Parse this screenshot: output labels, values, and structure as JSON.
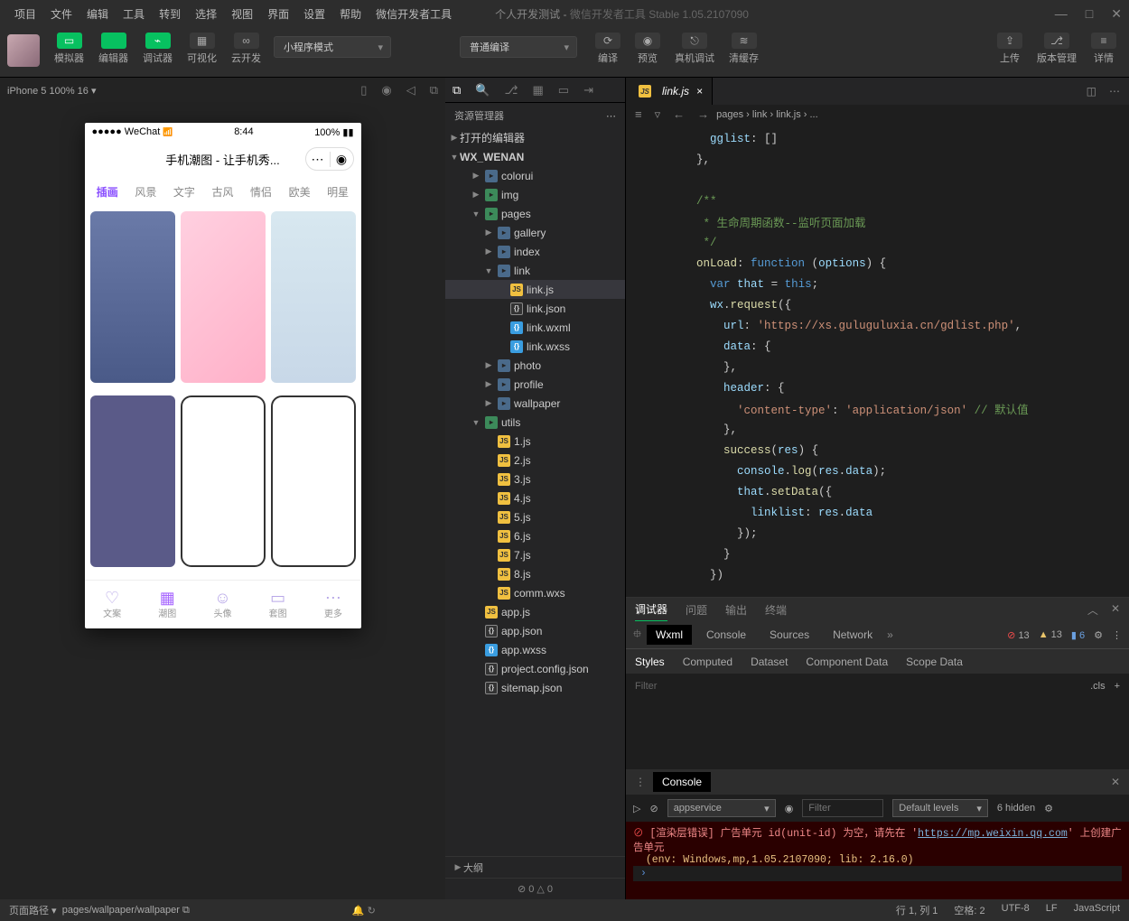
{
  "menubar": [
    "项目",
    "文件",
    "编辑",
    "工具",
    "转到",
    "选择",
    "视图",
    "界面",
    "设置",
    "帮助",
    "微信开发者工具"
  ],
  "title": {
    "project": "个人开发测试",
    "app": "微信开发者工具 Stable 1.05.2107090"
  },
  "win_controls": [
    "—",
    "□",
    "✕"
  ],
  "toolbar": {
    "left": [
      {
        "label": "模拟器",
        "cls": "green",
        "glyph": "▭"
      },
      {
        "label": "编辑器",
        "cls": "green",
        "glyph": "</>"
      },
      {
        "label": "调试器",
        "cls": "green",
        "glyph": "⌁"
      },
      {
        "label": "可视化",
        "cls": "grey",
        "glyph": "▦"
      },
      {
        "label": "云开发",
        "cls": "grey",
        "glyph": "∞"
      }
    ],
    "mode": "小程序模式",
    "compile": "普通编译",
    "mid": [
      {
        "label": "编译",
        "glyph": "⟳"
      },
      {
        "label": "预览",
        "glyph": "◉"
      },
      {
        "label": "真机调试",
        "glyph": "⎋"
      },
      {
        "label": "清缓存",
        "glyph": "≋"
      }
    ],
    "right": [
      {
        "label": "上传",
        "glyph": "⇪"
      },
      {
        "label": "版本管理",
        "glyph": "⎇"
      },
      {
        "label": "详情",
        "glyph": "≡"
      }
    ]
  },
  "simulator": {
    "device": "iPhone 5 100% 16",
    "status": {
      "carrier": "●●●●● WeChat",
      "signal": "",
      "time": "8:44",
      "battery": "100%"
    },
    "nav_title": "手机潮图 - 让手机秀...",
    "tabs": [
      "插画",
      "风景",
      "文字",
      "古风",
      "情侣",
      "欧美",
      "明星"
    ],
    "active_tab": 0,
    "bottom": [
      {
        "icon": "♡",
        "label": "文案"
      },
      {
        "icon": "▦",
        "label": "潮图",
        "act": true
      },
      {
        "icon": "☺",
        "label": "头像"
      },
      {
        "icon": "▭",
        "label": "套图"
      },
      {
        "icon": "⋯",
        "label": "更多"
      }
    ]
  },
  "explorer": {
    "title": "资源管理器",
    "sections": {
      "opened": "打开的编辑器",
      "project": "WX_WENAN"
    },
    "tree": [
      {
        "d": 2,
        "c": "▶",
        "i": "folder",
        "t": "colorui"
      },
      {
        "d": 2,
        "c": "▶",
        "i": "folder-g",
        "t": "img"
      },
      {
        "d": 2,
        "c": "▼",
        "i": "folder-g",
        "t": "pages"
      },
      {
        "d": 3,
        "c": "▶",
        "i": "folder",
        "t": "gallery"
      },
      {
        "d": 3,
        "c": "▶",
        "i": "folder",
        "t": "index"
      },
      {
        "d": 3,
        "c": "▼",
        "i": "folder",
        "t": "link"
      },
      {
        "d": 4,
        "c": "",
        "i": "js",
        "t": "link.js",
        "sel": true
      },
      {
        "d": 4,
        "c": "",
        "i": "json",
        "t": "link.json"
      },
      {
        "d": 4,
        "c": "",
        "i": "wxml",
        "t": "link.wxml"
      },
      {
        "d": 4,
        "c": "",
        "i": "wxss",
        "t": "link.wxss"
      },
      {
        "d": 3,
        "c": "▶",
        "i": "folder",
        "t": "photo"
      },
      {
        "d": 3,
        "c": "▶",
        "i": "folder",
        "t": "profile"
      },
      {
        "d": 3,
        "c": "▶",
        "i": "folder",
        "t": "wallpaper"
      },
      {
        "d": 2,
        "c": "▼",
        "i": "folder-g",
        "t": "utils"
      },
      {
        "d": 3,
        "c": "",
        "i": "js",
        "t": "1.js"
      },
      {
        "d": 3,
        "c": "",
        "i": "js",
        "t": "2.js"
      },
      {
        "d": 3,
        "c": "",
        "i": "js",
        "t": "3.js"
      },
      {
        "d": 3,
        "c": "",
        "i": "js",
        "t": "4.js"
      },
      {
        "d": 3,
        "c": "",
        "i": "js",
        "t": "5.js"
      },
      {
        "d": 3,
        "c": "",
        "i": "js",
        "t": "6.js"
      },
      {
        "d": 3,
        "c": "",
        "i": "js",
        "t": "7.js"
      },
      {
        "d": 3,
        "c": "",
        "i": "js",
        "t": "8.js"
      },
      {
        "d": 3,
        "c": "",
        "i": "js",
        "t": "comm.wxs"
      },
      {
        "d": 2,
        "c": "",
        "i": "js",
        "t": "app.js"
      },
      {
        "d": 2,
        "c": "",
        "i": "json",
        "t": "app.json"
      },
      {
        "d": 2,
        "c": "",
        "i": "wxss",
        "t": "app.wxss"
      },
      {
        "d": 2,
        "c": "",
        "i": "json",
        "t": "project.config.json"
      },
      {
        "d": 2,
        "c": "",
        "i": "json",
        "t": "sitemap.json"
      }
    ],
    "outline": "大纲",
    "errors": "⊘ 0 △ 0"
  },
  "editor": {
    "tab": "link.js",
    "breadcrumb": [
      "pages",
      "link",
      "link.js",
      "..."
    ],
    "code": [
      {
        "n": "",
        "h": "      <span class='tk-prop'>gglist</span>: []"
      },
      {
        "n": "",
        "h": "    },"
      },
      {
        "n": "",
        "h": ""
      },
      {
        "n": "",
        "h": "    <span class='tk-com'>/**</span>"
      },
      {
        "n": "",
        "h": "<span class='tk-com'>     * 生命周期函数--监听页面加载</span>"
      },
      {
        "n": "",
        "h": "<span class='tk-com'>     */</span>"
      },
      {
        "n": "",
        "h": "    <span class='tk-fn'>onLoad</span>: <span class='tk-blue'>function</span> (<span class='tk-prop'>options</span>) {"
      },
      {
        "n": "",
        "h": "      <span class='tk-blue'>var</span> <span class='tk-prop'>that</span> = <span class='tk-blue'>this</span>;"
      },
      {
        "n": "",
        "h": "      <span class='tk-prop'>wx</span>.<span class='tk-fn'>request</span>({"
      },
      {
        "n": "",
        "h": "        <span class='tk-prop'>url</span>: <span class='tk-str'>'https://xs.guluguluxia.cn/gdlist.php'</span>,"
      },
      {
        "n": "",
        "h": "        <span class='tk-prop'>data</span>: {"
      },
      {
        "n": "",
        "h": "        },"
      },
      {
        "n": "",
        "h": "        <span class='tk-prop'>header</span>: {"
      },
      {
        "n": "",
        "h": "          <span class='tk-str'>'content-type'</span>: <span class='tk-str'>'application/json'</span> <span class='tk-com'>// 默认值</span>"
      },
      {
        "n": "",
        "h": "        },"
      },
      {
        "n": "",
        "h": "        <span class='tk-fn'>success</span>(<span class='tk-prop'>res</span>) {"
      },
      {
        "n": "",
        "h": "          <span class='tk-prop'>console</span>.<span class='tk-fn'>log</span>(<span class='tk-prop'>res</span>.<span class='tk-prop'>data</span>);"
      },
      {
        "n": "",
        "h": "          <span class='tk-prop'>that</span>.<span class='tk-fn'>setData</span>({"
      },
      {
        "n": "",
        "h": "            <span class='tk-prop'>linklist</span>: <span class='tk-prop'>res</span>.<span class='tk-prop'>data</span>"
      },
      {
        "n": "",
        "h": "          });"
      },
      {
        "n": "",
        "h": "        }"
      },
      {
        "n": "",
        "h": "      })"
      }
    ]
  },
  "debugger": {
    "head": [
      "调试器",
      "问题",
      "输出",
      "终端"
    ],
    "tabs": [
      "Wxml",
      "Console",
      "Sources",
      "Network"
    ],
    "counts": {
      "err": "13",
      "warn": "13",
      "info": "6"
    },
    "styles_tabs": [
      "Styles",
      "Computed",
      "Dataset",
      "Component Data",
      "Scope Data"
    ],
    "filter": "Filter",
    "cls": ".cls",
    "console_title": "Console",
    "ctx": "appservice",
    "filter2": "Filter",
    "levels": "Default levels",
    "hidden": "6 hidden",
    "msg": {
      "pre": "[渲染层错误] 广告单元 id(unit-id) 为空，请先在 '",
      "url": "https://mp.weixin.qq.com",
      "post": "' 上创建广告单元",
      "env": "(env: Windows,mp,1.05.2107090; lib: 2.16.0)"
    }
  },
  "statusbar": {
    "left_label": "页面路径",
    "path": "pages/wallpaper/wallpaper",
    "right": [
      "行 1, 列 1",
      "空格: 2",
      "UTF-8",
      "LF",
      "JavaScript"
    ]
  }
}
